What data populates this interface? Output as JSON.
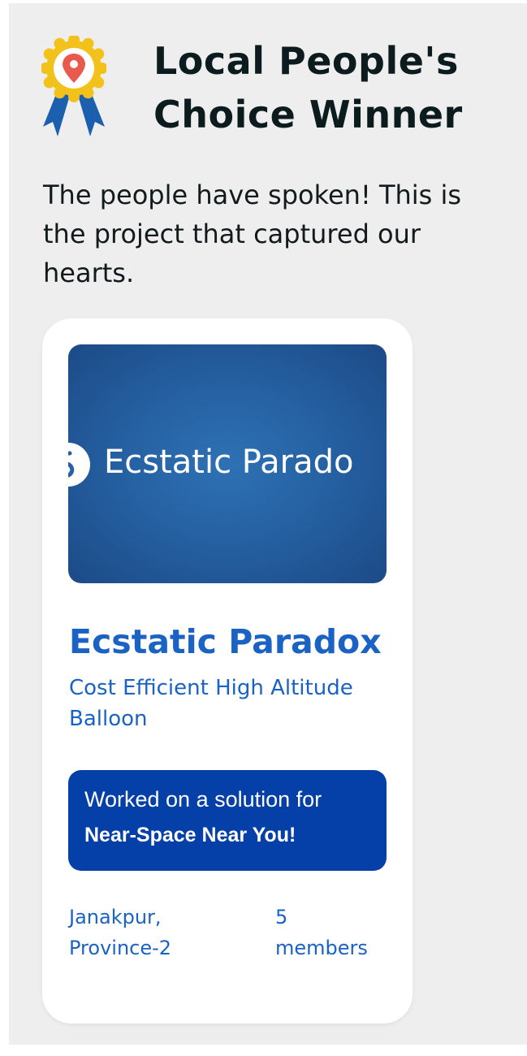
{
  "section": {
    "title_line1": "Local People's",
    "title_line2": "Choice Winner",
    "subtitle": "The people have spoken! This is the project that captured our hearts.",
    "icon": "award-ribbon-location-icon"
  },
  "winner": {
    "thumbnail_text": "Ecstatic Parado",
    "name": "Ecstatic Paradox",
    "tagline": "Cost Efficient High Altitude Balloon",
    "challenge_intro": "Worked on a solution for",
    "challenge_name": "Near-Space Near You!",
    "location_line1": "Janakpur,",
    "location_line2": "Province-2",
    "members_count": "5",
    "members_label": "members"
  },
  "colors": {
    "panel_bg": "#eeeeee",
    "accent_blue": "#1a63c5",
    "challenge_bg": "#0540a8",
    "ribbon_gold": "#f2c21b",
    "ribbon_blue": "#1c5fae",
    "pin_red": "#ea5a4c"
  }
}
